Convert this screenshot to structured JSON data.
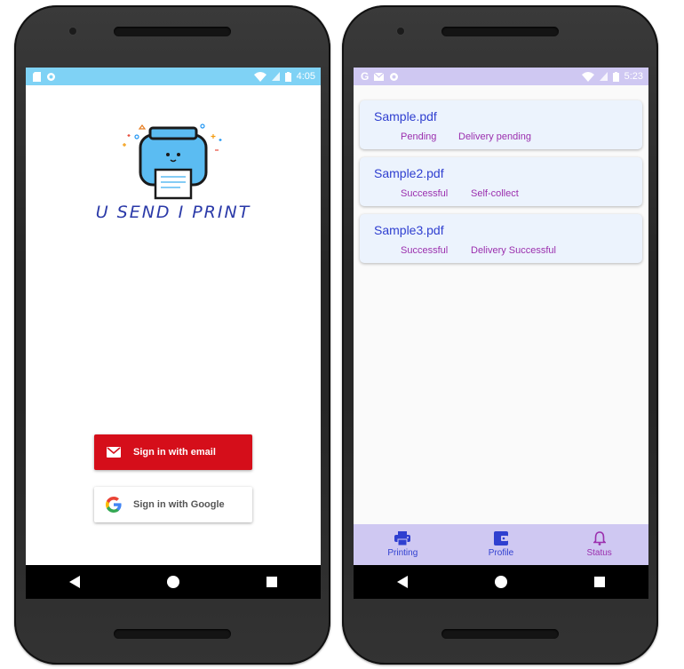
{
  "phone1": {
    "status_time": "4:05",
    "app_name": "U SEND I PRINT",
    "email_button_label": "Sign in with email",
    "google_button_label": "Sign in with Google"
  },
  "phone2": {
    "status_time": "5:23",
    "files": [
      {
        "name": "Sample.pdf",
        "status": "Pending",
        "delivery": "Delivery pending"
      },
      {
        "name": "Sample2.pdf",
        "status": "Successful",
        "delivery": "Self-collect"
      },
      {
        "name": "Sample3.pdf",
        "status": "Successful",
        "delivery": "Delivery Successful"
      }
    ],
    "nav": [
      {
        "label": "Printing",
        "icon": "printer-icon"
      },
      {
        "label": "Profile",
        "icon": "wallet-icon"
      },
      {
        "label": "Status",
        "icon": "bell-icon"
      }
    ]
  },
  "colors": {
    "status_bar_1": "#7fd2f5",
    "status_bar_2": "#cfc8f2",
    "email_button": "#d50e1a",
    "file_title": "#2f3fd0",
    "file_status": "#9b2fae",
    "nav_primary": "#2f3fd0",
    "nav_secondary": "#9b2fae"
  }
}
